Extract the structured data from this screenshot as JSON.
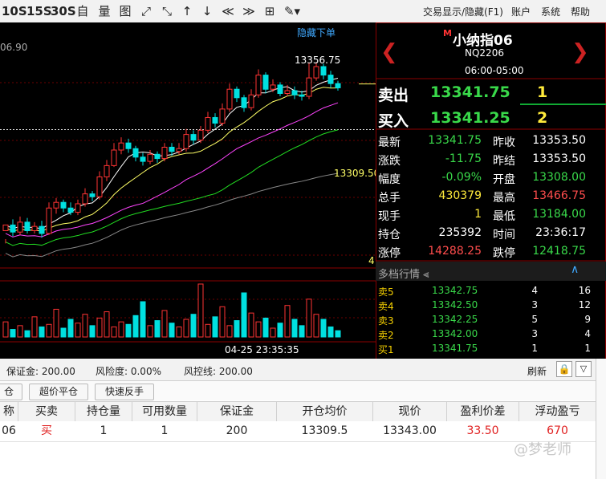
{
  "toolbar": {
    "periods": [
      "10S",
      "15S",
      "30S"
    ],
    "icons": [
      "自",
      "量",
      "图"
    ],
    "menu": [
      "交易显示/隐藏(F1)",
      "账户",
      "系统",
      "帮助"
    ]
  },
  "chart": {
    "hide_order_label": "隐藏下单",
    "top_left_price": "06.90",
    "high_label": "13356.75",
    "entry_price_label": "13309.50",
    "right_marker": "4",
    "time_label": "04-25 23:35:35",
    "colors": {
      "up": "#ff3333",
      "down": "#00e0e0",
      "ma5": "#ffffff",
      "ma10": "#ffff66",
      "ma20": "#ff44ff",
      "ma30": "#22dd22",
      "ma60": "#888888"
    }
  },
  "chart_data": {
    "type": "candlestick",
    "ylim": [
      13215,
      13375
    ],
    "candles": [
      [
        13238,
        13242,
        13232,
        13229
      ],
      [
        13242,
        13237,
        13246,
        13234
      ],
      [
        13237,
        13244,
        13248,
        13235
      ],
      [
        13244,
        13238,
        13247,
        13236
      ],
      [
        13238,
        13241,
        13244,
        13236
      ],
      [
        13241,
        13236,
        13245,
        13233
      ],
      [
        13236,
        13254,
        13258,
        13235
      ],
      [
        13254,
        13258,
        13261,
        13250
      ],
      [
        13258,
        13254,
        13260,
        13251
      ],
      [
        13254,
        13251,
        13258,
        13249
      ],
      [
        13251,
        13257,
        13260,
        13249
      ],
      [
        13257,
        13264,
        13268,
        13255
      ],
      [
        13264,
        13262,
        13266,
        13259
      ],
      [
        13262,
        13276,
        13280,
        13260
      ],
      [
        13276,
        13284,
        13288,
        13273
      ],
      [
        13284,
        13295,
        13300,
        13283
      ],
      [
        13295,
        13300,
        13304,
        13292
      ],
      [
        13300,
        13296,
        13303,
        13293
      ],
      [
        13296,
        13290,
        13298,
        13287
      ],
      [
        13290,
        13287,
        13293,
        13284
      ],
      [
        13287,
        13292,
        13295,
        13285
      ],
      [
        13292,
        13289,
        13294,
        13286
      ],
      [
        13289,
        13297,
        13300,
        13287
      ],
      [
        13297,
        13294,
        13300,
        13291
      ],
      [
        13294,
        13296,
        13300,
        13292
      ],
      [
        13296,
        13306,
        13310,
        13294
      ],
      [
        13306,
        13302,
        13309,
        13299
      ],
      [
        13302,
        13309,
        13312,
        13300
      ],
      [
        13309,
        13318,
        13322,
        13307
      ],
      [
        13318,
        13314,
        13321,
        13311
      ],
      [
        13314,
        13324,
        13328,
        13312
      ],
      [
        13324,
        13338,
        13342,
        13322
      ],
      [
        13338,
        13332,
        13340,
        13329
      ],
      [
        13332,
        13325,
        13334,
        13322
      ],
      [
        13325,
        13334,
        13338,
        13323
      ],
      [
        13334,
        13348,
        13352,
        13332
      ],
      [
        13348,
        13338,
        13350,
        13335
      ],
      [
        13338,
        13341,
        13345,
        13336
      ],
      [
        13341,
        13335,
        13343,
        13333
      ],
      [
        13335,
        13337,
        13341,
        13333
      ],
      [
        13337,
        13334,
        13340,
        13331
      ],
      [
        13334,
        13333,
        13337,
        13330
      ],
      [
        13333,
        13346,
        13357,
        13331
      ],
      [
        13346,
        13354,
        13357,
        13344
      ],
      [
        13354,
        13348,
        13356,
        13345
      ],
      [
        13348,
        13342,
        13351,
        13339
      ],
      [
        13342,
        13339,
        13344,
        13337
      ]
    ],
    "volumes": [
      12,
      6,
      9,
      5,
      16,
      8,
      10,
      22,
      7,
      14,
      11,
      18,
      9,
      15,
      20,
      8,
      12,
      10,
      17,
      28,
      9,
      13,
      21,
      11,
      8,
      14,
      18,
      42,
      10,
      16,
      24,
      9,
      13,
      35,
      19,
      12,
      15,
      7,
      11,
      25,
      14,
      9,
      30,
      18,
      14,
      8,
      5
    ]
  },
  "quote": {
    "name": "小纳指06",
    "name_prefix": "M",
    "code": "NQ2206",
    "hours": "06:00-05:00",
    "sell_label": "卖出",
    "sell_price": "13341.75",
    "sell_qty": "1",
    "buy_label": "买入",
    "buy_price": "13341.25",
    "buy_qty": "2",
    "stats": [
      {
        "l1": "最新",
        "v1": "13341.75",
        "c1": "#39d94a",
        "l2": "昨收",
        "v2": "13353.50",
        "c2": "#ffffff"
      },
      {
        "l1": "涨跌",
        "v1": "-11.75",
        "c1": "#39d94a",
        "l2": "昨结",
        "v2": "13353.50",
        "c2": "#ffffff"
      },
      {
        "l1": "幅度",
        "v1": "-0.09%",
        "c1": "#39d94a",
        "l2": "开盘",
        "v2": "13308.00",
        "c2": "#39d94a"
      },
      {
        "l1": "总手",
        "v1": "430379",
        "c1": "#ffeb3b",
        "l2": "最高",
        "v2": "13466.75",
        "c2": "#ff4d4d"
      },
      {
        "l1": "现手",
        "v1": "1",
        "c1": "#ffeb3b",
        "l2": "最低",
        "v2": "13184.00",
        "c2": "#39d94a"
      },
      {
        "l1": "持仓",
        "v1": "235392",
        "c1": "#ffffff",
        "l2": "时间",
        "v2": "23:36:17",
        "c2": "#ffffff"
      },
      {
        "l1": "涨停",
        "v1": "14288.25",
        "c1": "#ff4d4d",
        "l2": "跌停",
        "v2": "12418.75",
        "c2": "#39d94a"
      }
    ],
    "depth_title": "多档行情",
    "depth": [
      {
        "label": "卖5",
        "price": "13342.75",
        "qty": "4",
        "count": "16"
      },
      {
        "label": "卖4",
        "price": "13342.50",
        "qty": "3",
        "count": "12"
      },
      {
        "label": "卖3",
        "price": "13342.25",
        "qty": "5",
        "count": "9"
      },
      {
        "label": "卖2",
        "price": "13342.00",
        "qty": "3",
        "count": "4"
      },
      {
        "label": "买1",
        "price": "13341.75",
        "qty": "1",
        "count": "1"
      }
    ]
  },
  "status": {
    "margin": "保证金: 200.00",
    "risk": "风险度: 0.00%",
    "control": "风控线: 200.00",
    "refresh": "刷新"
  },
  "buttons": [
    "仓",
    "超价平仓",
    "快速反手"
  ],
  "table": {
    "headers": [
      "称",
      "买卖",
      "持仓量",
      "可用数量",
      "保证金",
      "开仓均价",
      "现价",
      "盈利价差",
      "浮动盈亏"
    ],
    "row": [
      "06",
      "买",
      "1",
      "1",
      "200",
      "13309.5",
      "13343.00",
      "33.50",
      "670"
    ]
  },
  "watermark": "@梦老师"
}
